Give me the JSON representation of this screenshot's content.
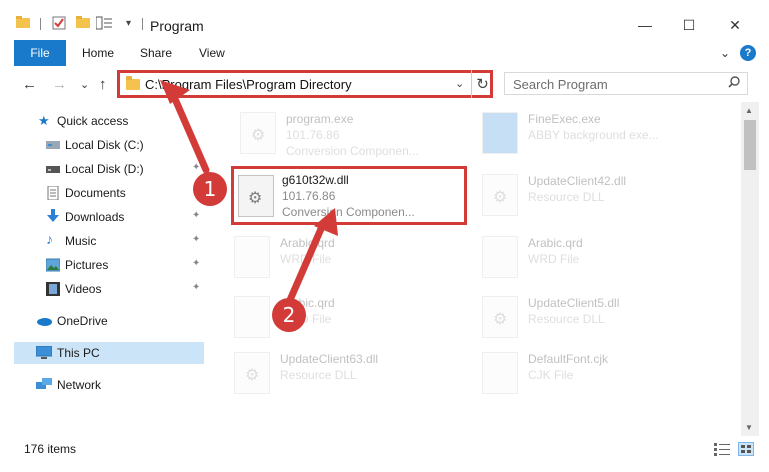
{
  "window": {
    "title": "Program",
    "controls": {
      "minimize": "—",
      "maximize": "☐",
      "close": "✕"
    }
  },
  "ribbon": {
    "tabs": [
      "File",
      "Home",
      "Share",
      "View"
    ],
    "expand_glyph": "⌄",
    "help": "?"
  },
  "nav": {
    "back": "←",
    "forward": "→",
    "recent": "⌄",
    "up": "↑"
  },
  "address": {
    "path": "C:\\Program Files\\Program Directory",
    "dropdown": "⌄",
    "refresh": "↻"
  },
  "search": {
    "placeholder": "Search Program",
    "icon": "search-icon"
  },
  "sidebar": {
    "items": [
      {
        "label": "Quick access",
        "icon": "star-icon",
        "pinned": false
      },
      {
        "label": "Local Disk (C:)",
        "icon": "drive-icon",
        "pinned": false
      },
      {
        "label": "Local Disk (D:)",
        "icon": "drive-icon",
        "pinned": true
      },
      {
        "label": "Documents",
        "icon": "document-icon",
        "pinned": true
      },
      {
        "label": "Downloads",
        "icon": "download-icon",
        "pinned": true
      },
      {
        "label": "Music",
        "icon": "music-icon",
        "pinned": true
      },
      {
        "label": "Pictures",
        "icon": "pictures-icon",
        "pinned": true
      },
      {
        "label": "Videos",
        "icon": "video-icon",
        "pinned": true
      },
      {
        "label": "OneDrive",
        "icon": "cloud-icon",
        "pinned": false
      },
      {
        "label": "This PC",
        "icon": "computer-icon",
        "pinned": false,
        "selected": true
      },
      {
        "label": "Network",
        "icon": "network-icon",
        "pinned": false
      }
    ],
    "pin_glyph": "📌"
  },
  "files": [
    {
      "name": "program.exe",
      "line2": "101.76.86",
      "line3": "Conversion Componen...",
      "faded": true
    },
    {
      "name": "FineExec.exe",
      "line2": "ABBY background exe...",
      "line3": "",
      "faded": true
    },
    {
      "name": "UpdateClient42.dll",
      "line2": "Resource DLL",
      "line3": "",
      "faded": true
    },
    {
      "name": "Arabic.qrd",
      "line2": "WRD File",
      "line3": "",
      "faded": true
    },
    {
      "name": "Arabic.qrd",
      "line2": "WRD File",
      "line3": "",
      "faded": true
    },
    {
      "name": "Arabic.qrd",
      "line2": "WRD File",
      "line3": "",
      "faded": true
    },
    {
      "name": "UpdateClient5.dll",
      "line2": "Resource DLL",
      "line3": "",
      "faded": true
    },
    {
      "name": "UpdateClient63.dll",
      "line2": "Resource DLL",
      "line3": "",
      "faded": true
    },
    {
      "name": "DefaultFont.cjk",
      "line2": "CJK File",
      "line3": "",
      "faded": true
    }
  ],
  "highlighted_file": {
    "name": "g610t32w.dll",
    "line2": "101.76.86",
    "line3": "Conversion Componen..."
  },
  "annotations": {
    "badge1": "1",
    "badge2": "2",
    "color": "#d23b38"
  },
  "status": {
    "item_count": "176 items"
  },
  "colors": {
    "accent": "#1979ca",
    "selection": "#cce4f7",
    "highlight_border": "#d23b38"
  }
}
